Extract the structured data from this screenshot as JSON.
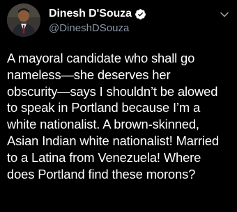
{
  "tweet": {
    "display_name": "Dinesh D'Souza",
    "handle": "@DineshDSouza",
    "verified": true,
    "icons": {
      "verified": "verified-badge-icon",
      "more": "chevron-down-icon",
      "avatar": "avatar-photo"
    },
    "colors": {
      "background": "#000000",
      "text": "#ffffff",
      "secondary": "#8b98a5",
      "verified_badge": "#ffffff"
    },
    "body_lines": [
      "A mayoral candidate who shall go",
      "nameless—she deserves her",
      "obscurity—says I shouldn’t be alowed",
      "to speak in Portland because I’m a",
      "white nationalist. A brown-skinned,",
      "Asian Indian white nationalist!  Married",
      "to a Latina from Venezuela! Where",
      "does Portland find these morons?"
    ]
  }
}
